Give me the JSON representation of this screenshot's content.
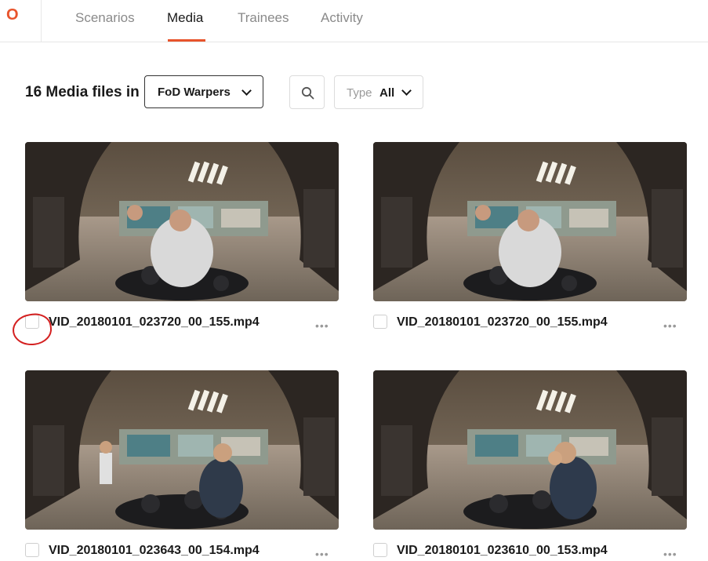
{
  "nav": {
    "logo_text": "O",
    "tabs": [
      {
        "label": "Scenarios",
        "active": false
      },
      {
        "label": "Media",
        "active": true
      },
      {
        "label": "Trainees",
        "active": false
      },
      {
        "label": "Activity",
        "active": false
      }
    ]
  },
  "toolbar": {
    "count_title": "16 Media files in",
    "folder": "FoD Warpers",
    "type_label": "Type",
    "type_value": "All"
  },
  "colors": {
    "accent": "#e8542c",
    "annotation": "#d42020"
  },
  "media": [
    {
      "filename": "VID_20180101_023720_00_155.mp4",
      "more": "•••",
      "checked": false
    },
    {
      "filename": "VID_20180101_023720_00_155.mp4",
      "more": "•••",
      "checked": false
    },
    {
      "filename": "VID_20180101_023643_00_154.mp4",
      "more": "•••",
      "checked": false
    },
    {
      "filename": "VID_20180101_023610_00_153.mp4",
      "more": "•••",
      "checked": false
    }
  ]
}
